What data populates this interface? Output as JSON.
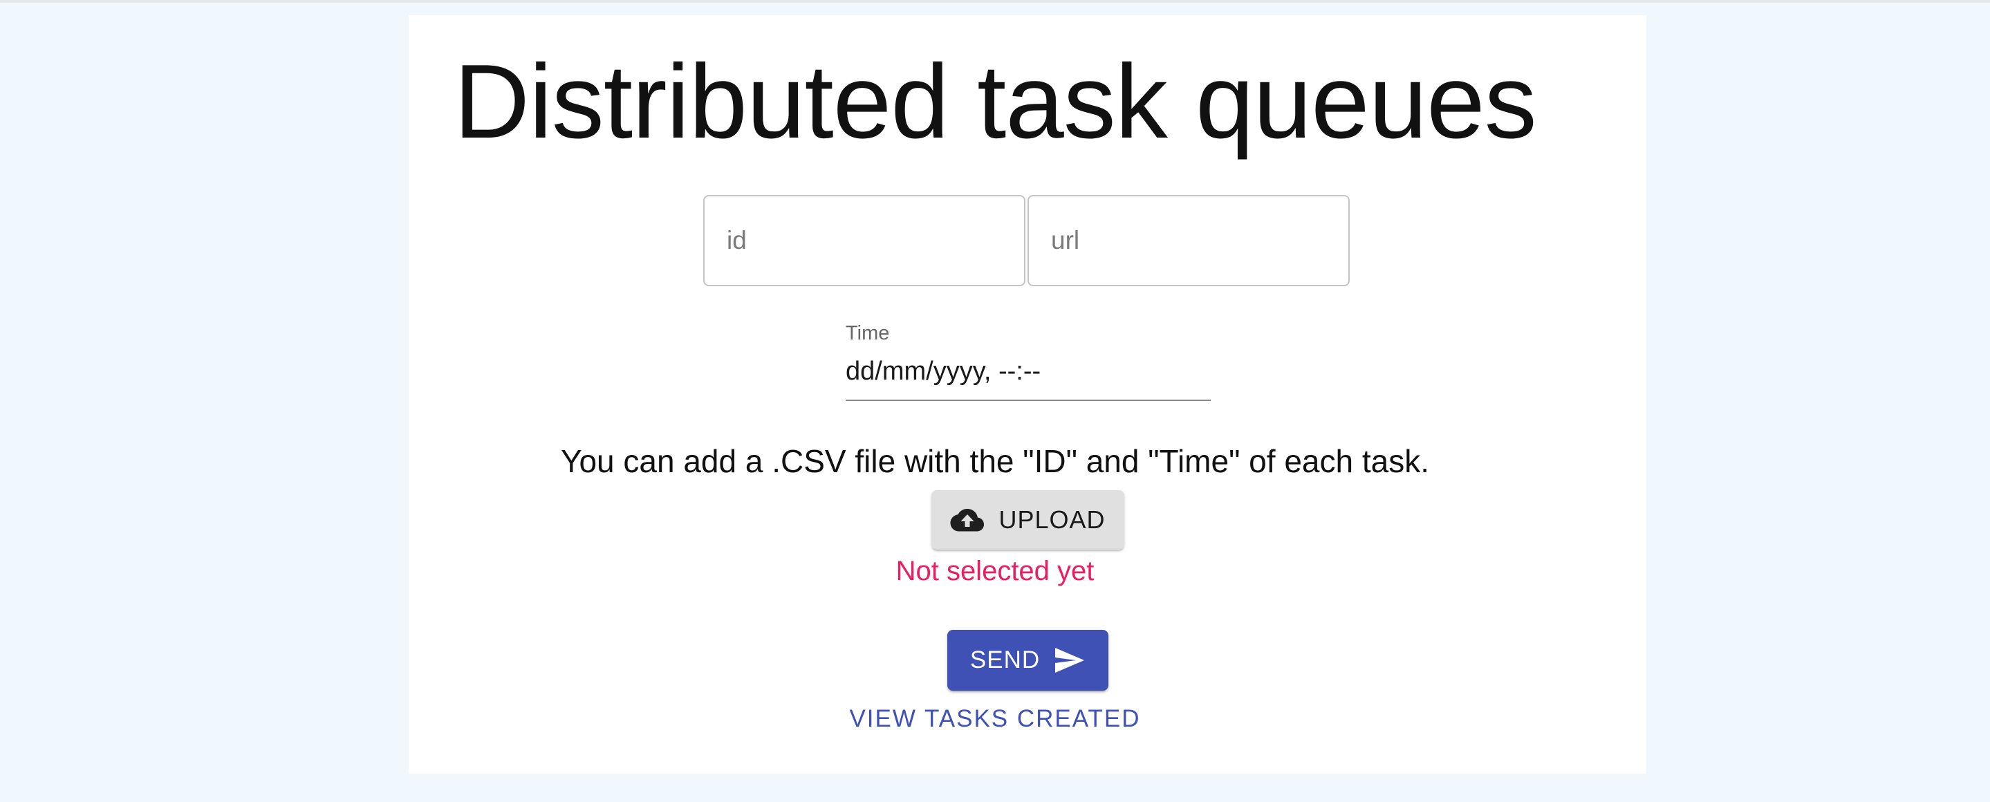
{
  "page": {
    "title": "Distributed task queues"
  },
  "form": {
    "id_placeholder": "id",
    "url_placeholder": "url",
    "time_label": "Time",
    "time_value": "dd/mm/yyyy, --:--"
  },
  "csv": {
    "info_text": "You can add a .CSV file with the \"ID\" and \"Time\" of each task.",
    "upload_label": "UPLOAD",
    "upload_icon": "cloud-upload-icon",
    "status": "Not selected yet"
  },
  "actions": {
    "send_label": "SEND",
    "send_icon": "send-icon",
    "view_tasks_label": "VIEW TASKS CREATED"
  },
  "colors": {
    "page_background": "#f1f8fd",
    "primary": "#3f51b5",
    "error": "#e91e63",
    "upload_button": "#e0e0e0"
  }
}
